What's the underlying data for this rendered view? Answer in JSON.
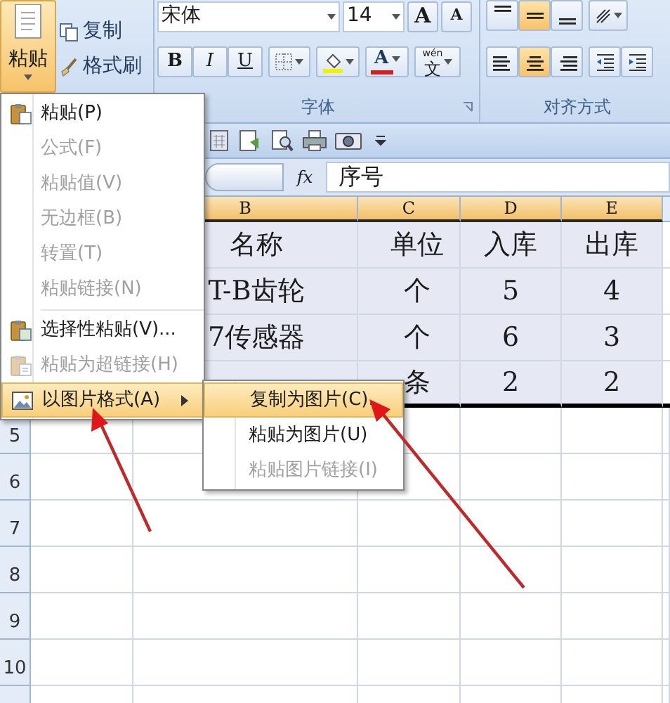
{
  "ribbon": {
    "paste_button": "粘贴",
    "clipboard_items": [
      "复制",
      "格式刷"
    ],
    "font_name": "宋体",
    "font_size": "14",
    "font_size_buttons": [
      "A",
      "A"
    ],
    "style_buttons": [
      "B",
      "I",
      "U"
    ],
    "font_color_button": "A",
    "phonetic_button": {
      "top": "wén",
      "main": "文"
    },
    "vertical_align": [
      {
        "selected": false
      },
      {
        "selected": true
      },
      {
        "selected": false
      }
    ],
    "horizontal_align": [
      {
        "selected": false
      },
      {
        "selected": true
      },
      {
        "selected": false
      }
    ],
    "group_labels": [
      "字体",
      "对齐方式"
    ]
  },
  "formula_bar": {
    "fx": "fx",
    "value": "序号"
  },
  "sheet": {
    "columns": [
      {
        "label": "B",
        "selected": true
      },
      {
        "label": "C",
        "selected": true
      },
      {
        "label": "D",
        "selected": true
      },
      {
        "label": "E",
        "selected": true
      }
    ],
    "rows": [
      {
        "cells": [
          "名称",
          "单位",
          "入库",
          "出库"
        ]
      },
      {
        "cells": [
          "T-B齿轮",
          "个",
          "5",
          "4"
        ]
      },
      {
        "cells": [
          "7传感器",
          "个",
          "6",
          "3"
        ]
      },
      {
        "cells": [
          "",
          "条",
          "2",
          "2"
        ]
      }
    ],
    "row_numbers": [
      "5",
      "6",
      "7",
      "8",
      "9",
      "10"
    ]
  },
  "paste_menu": {
    "groups": [
      [
        {
          "label": "粘贴(P)",
          "kind": "paste",
          "disabled": false,
          "selected": false,
          "submenu": false
        },
        {
          "label": "公式(F)",
          "kind": "plain",
          "disabled": true,
          "selected": false,
          "submenu": false
        },
        {
          "label": "粘贴值(V)",
          "kind": "plain",
          "disabled": true,
          "selected": false,
          "submenu": false
        },
        {
          "label": "无边框(B)",
          "kind": "plain",
          "disabled": true,
          "selected": false,
          "submenu": false
        },
        {
          "label": "转置(T)",
          "kind": "plain",
          "disabled": true,
          "selected": false,
          "submenu": false
        },
        {
          "label": "粘贴链接(N)",
          "kind": "plain",
          "disabled": true,
          "selected": false,
          "submenu": false
        }
      ],
      [
        {
          "label": "选择性粘贴(V)...",
          "kind": "special",
          "disabled": false,
          "selected": false,
          "submenu": false
        },
        {
          "label": "粘贴为超链接(H)",
          "kind": "hyperlink",
          "disabled": true,
          "selected": false,
          "submenu": false
        },
        {
          "label": "以图片格式(A)",
          "kind": "picture",
          "disabled": false,
          "selected": true,
          "submenu": true
        }
      ]
    ]
  },
  "picture_submenu": {
    "items": [
      {
        "label": "复制为图片(C).",
        "disabled": false,
        "selected": true
      },
      {
        "label": "粘贴为图片(U)",
        "disabled": false,
        "selected": false
      },
      {
        "label": "粘贴图片链接(I)",
        "disabled": true,
        "selected": false
      }
    ]
  }
}
